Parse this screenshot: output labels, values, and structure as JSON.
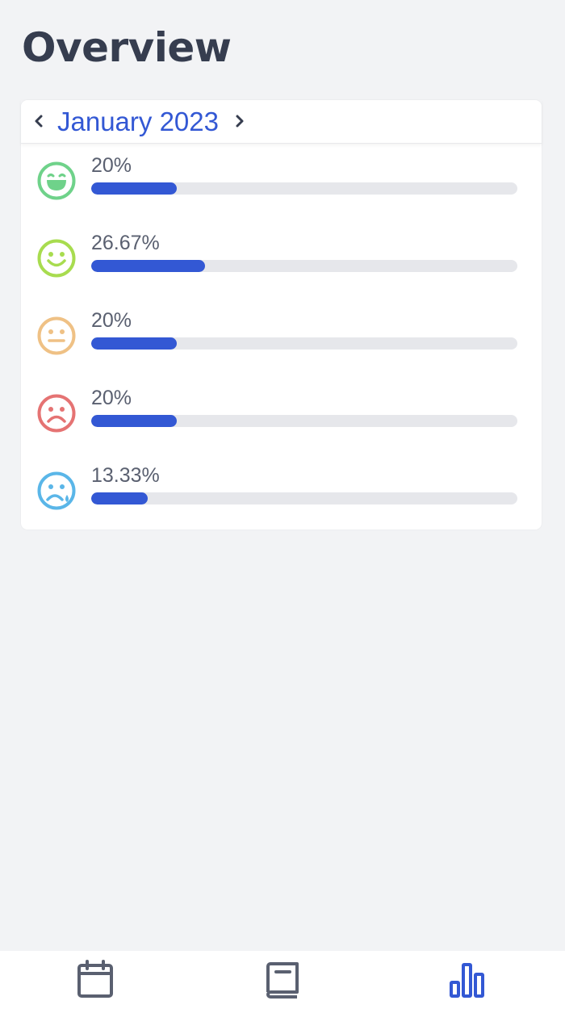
{
  "page": {
    "title": "Overview"
  },
  "month_nav": {
    "label": "January 2023",
    "prev_icon": "chevron-left-icon",
    "next_icon": "chevron-right-icon"
  },
  "moods": [
    {
      "name": "ecstatic",
      "icon": "laughing-face-icon",
      "color": "#6fd28a",
      "percent_label": "20%",
      "percent": 20
    },
    {
      "name": "happy",
      "icon": "smiling-face-icon",
      "color": "#a8dc4f",
      "percent_label": "26.67%",
      "percent": 26.67
    },
    {
      "name": "neutral",
      "icon": "neutral-face-icon",
      "color": "#efc185",
      "percent_label": "20%",
      "percent": 20
    },
    {
      "name": "sad",
      "icon": "frowning-face-icon",
      "color": "#e57373",
      "percent_label": "20%",
      "percent": 20
    },
    {
      "name": "crying",
      "icon": "crying-face-icon",
      "color": "#5ab6e8",
      "percent_label": "13.33%",
      "percent": 13.33
    }
  ],
  "bottom_nav": {
    "tabs": [
      {
        "name": "calendar",
        "icon": "calendar-icon",
        "active": false
      },
      {
        "name": "journal",
        "icon": "book-icon",
        "active": false
      },
      {
        "name": "stats",
        "icon": "bar-chart-icon",
        "active": true
      }
    ],
    "active_color": "#3358d4",
    "inactive_color": "#5a6070"
  },
  "colors": {
    "accent": "#3358d4",
    "background": "#f2f3f5",
    "bar_track": "#e6e7eb"
  }
}
